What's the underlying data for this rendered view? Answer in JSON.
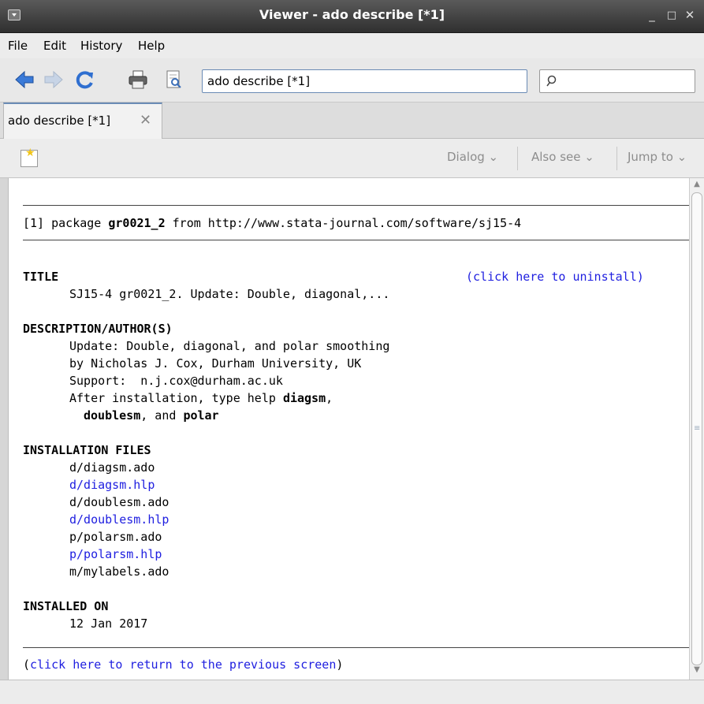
{
  "window": {
    "title": "Viewer - ado describe [*1]",
    "minimize": "_",
    "maximize": "□",
    "close": "✕"
  },
  "menu": {
    "file": "File",
    "edit": "Edit",
    "history": "History",
    "help": "Help"
  },
  "toolbar": {
    "url_value": "ado describe [*1]",
    "search_value": ""
  },
  "tab": {
    "label": "ado describe [*1]",
    "close": "✕"
  },
  "viewer_toolbar": {
    "dialog": "Dialog",
    "also_see": "Also see",
    "jump_to": "Jump to"
  },
  "doc": {
    "header_prefix": "[1] package ",
    "package_name": "gr0021_2",
    "header_suffix": " from http://www.stata-journal.com/software/sj15-4",
    "title_heading": "TITLE",
    "uninstall_link": "(click here to uninstall)",
    "title_text": "SJ15-4 gr0021_2. Update: Double, diagonal,...",
    "desc_heading": "DESCRIPTION/AUTHOR(S)",
    "desc_line1": "Update: Double, diagonal, and polar smoothing",
    "desc_line2": "by Nicholas J. Cox, Durham University, UK",
    "desc_line3": "Support:  n.j.cox@durham.ac.uk",
    "desc_line4_pre": "After installation, type help ",
    "desc_line4_bold": "diagsm",
    "desc_line4_post": ",",
    "desc_line5_bold1": "doublesm",
    "desc_line5_mid": ", and ",
    "desc_line5_bold2": "polar",
    "files_heading": "INSTALLATION FILES",
    "files": [
      {
        "name": "d/diagsm.ado",
        "link": false
      },
      {
        "name": "d/diagsm.hlp",
        "link": true
      },
      {
        "name": "d/doublesm.ado",
        "link": false
      },
      {
        "name": "d/doublesm.hlp",
        "link": true
      },
      {
        "name": "p/polarsm.ado",
        "link": false
      },
      {
        "name": "p/polarsm.hlp",
        "link": true
      },
      {
        "name": "m/mylabels.ado",
        "link": false
      }
    ],
    "installed_heading": "INSTALLED ON",
    "installed_date": "12 Jan 2017",
    "return_open": "(",
    "return_link": "click here to return to the previous screen",
    "return_close": ")"
  },
  "colors": {
    "link": "#2020e0",
    "accent": "#6a8bb5",
    "titlebar": "#3c3c3c"
  },
  "icons": [
    "window-menu-icon",
    "back-arrow-icon",
    "forward-arrow-icon",
    "refresh-icon",
    "print-icon",
    "find-in-page-icon",
    "search-icon",
    "new-viewer-icon",
    "chevron-down-icon"
  ]
}
